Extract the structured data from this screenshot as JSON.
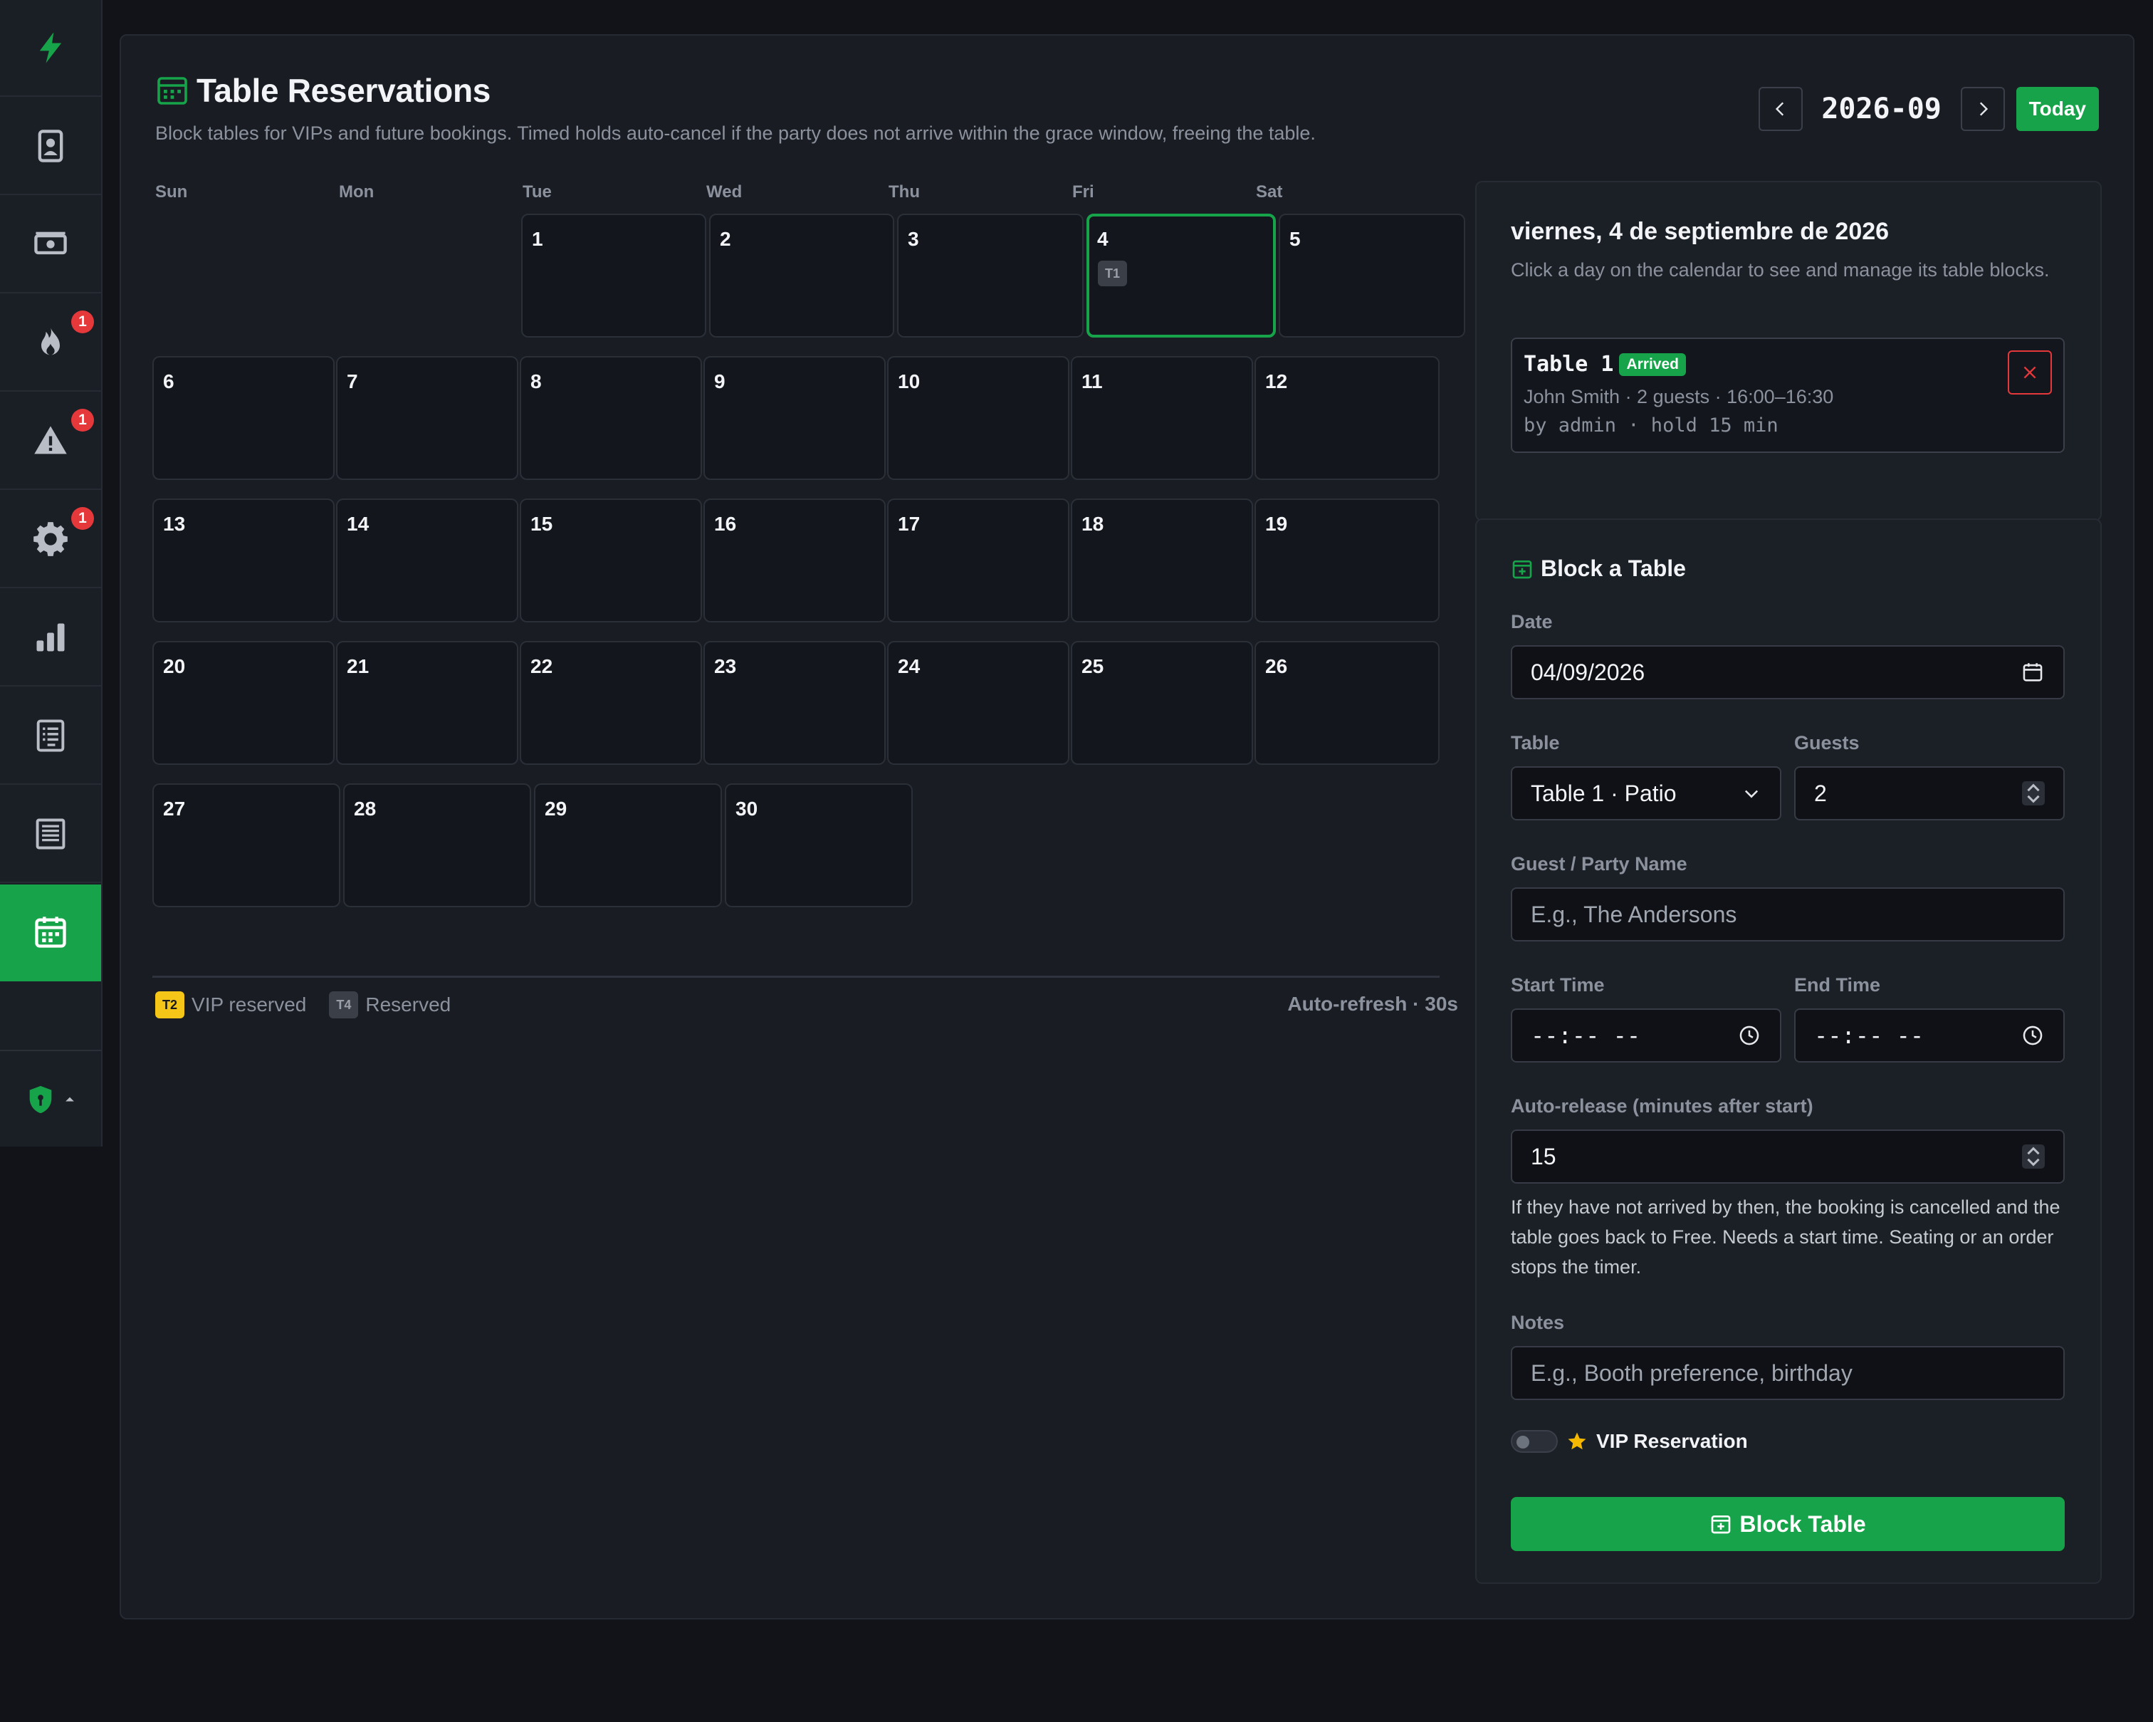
{
  "sidebar": {
    "items": [
      {
        "icon": "lightning-icon",
        "badge": ""
      },
      {
        "icon": "id-card-icon",
        "badge": ""
      },
      {
        "icon": "cash-icon",
        "badge": ""
      },
      {
        "icon": "flame-icon",
        "badge": "1"
      },
      {
        "icon": "warning-icon",
        "badge": "1"
      },
      {
        "icon": "gear-icon",
        "badge": "1"
      },
      {
        "icon": "bar-chart-icon",
        "badge": ""
      },
      {
        "icon": "list-document-icon",
        "badge": ""
      },
      {
        "icon": "receipt-icon",
        "badge": ""
      },
      {
        "icon": "calendar-icon",
        "badge": "",
        "active": true
      }
    ],
    "footer_icon": "shield-icon"
  },
  "header": {
    "title": "Table Reservations",
    "subtitle": "Block tables for VIPs and future bookings. Timed holds auto-cancel if the party does not arrive within the grace window, freeing the table.",
    "month": "2026-09",
    "today_label": "Today"
  },
  "calendar": {
    "weekdays": [
      "Sun",
      "Mon",
      "Tue",
      "Wed",
      "Thu",
      "Fri",
      "Sat"
    ],
    "days": [
      "1",
      "2",
      "3",
      "4",
      "5",
      "6",
      "7",
      "8",
      "9",
      "10",
      "11",
      "12",
      "13",
      "14",
      "15",
      "16",
      "17",
      "18",
      "19",
      "20",
      "21",
      "22",
      "23",
      "24",
      "25",
      "26",
      "27",
      "28",
      "29",
      "30"
    ],
    "selected_day": "4",
    "day4_chip": "T1"
  },
  "legend": {
    "vip_chip": "T2",
    "vip_label": "VIP reserved",
    "reserved_chip": "T4",
    "reserved_label": "Reserved",
    "auto_refresh": "Auto-refresh · 30s"
  },
  "day_panel": {
    "title": "viernes, 4 de septiembre de 2026",
    "help": "Click a day on the calendar to see and manage its table blocks.",
    "reservation": {
      "table": "Table 1",
      "status": "Arrived",
      "detail": "John Smith · 2 guests · 16:00–16:30",
      "meta": "by admin · hold 15 min"
    }
  },
  "form": {
    "title": "Block a Table",
    "date_label": "Date",
    "date_value": "04/09/2026",
    "table_label": "Table",
    "table_value": "Table 1 · Patio",
    "guests_label": "Guests",
    "guests_value": "2",
    "name_label": "Guest / Party Name",
    "name_placeholder": "E.g., The Andersons",
    "start_label": "Start Time",
    "start_placeholder": "--:-- --",
    "end_label": "End Time",
    "end_placeholder": "--:-- --",
    "release_label": "Auto-release (minutes after start)",
    "release_value": "15",
    "release_help": "If they have not arrived by then, the booking is cancelled and the table goes back to Free. Needs a start time. Seating or an order stops the timer.",
    "notes_label": "Notes",
    "notes_placeholder": "E.g., Booth preference, birthday",
    "vip_label": "VIP Reservation",
    "vip_enabled": false,
    "submit_label": "Block Table"
  },
  "colors": {
    "accent": "#16a34a",
    "danger": "#e5383b",
    "vip": "#f5c518",
    "background": "#111318",
    "panel": "#191c23"
  }
}
